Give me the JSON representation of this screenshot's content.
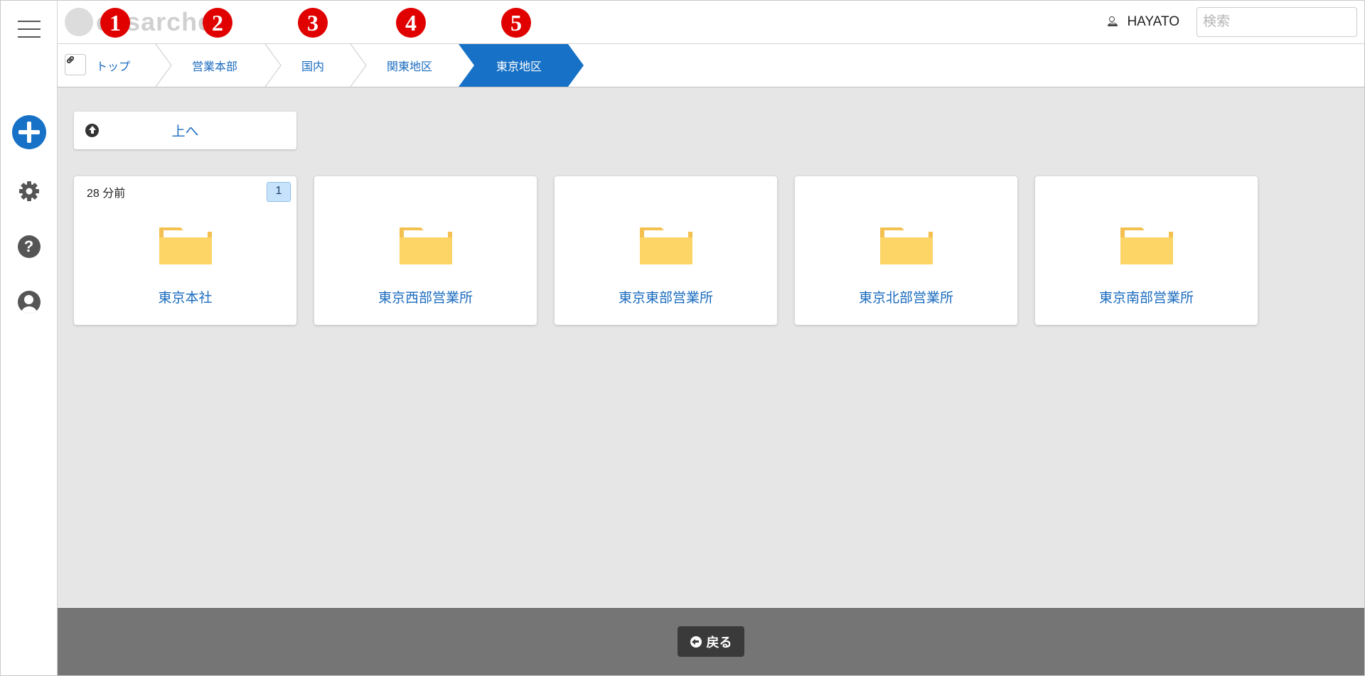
{
  "app": {
    "logo_text": "easarcher"
  },
  "annotations": [
    "1",
    "2",
    "3",
    "4",
    "5"
  ],
  "header": {
    "username": "HAYATO",
    "search_placeholder": "検索"
  },
  "breadcrumb": [
    {
      "label": "トップ",
      "active": false
    },
    {
      "label": "営業本部",
      "active": false
    },
    {
      "label": "国内",
      "active": false
    },
    {
      "label": "関東地区",
      "active": false
    },
    {
      "label": "東京地区",
      "active": true
    }
  ],
  "toolbar": {
    "up_label": "上へ"
  },
  "folders": [
    {
      "name": "東京本社",
      "updated": "28 分前",
      "count": "1"
    },
    {
      "name": "東京西部営業所"
    },
    {
      "name": "東京東部営業所"
    },
    {
      "name": "東京北部営業所"
    },
    {
      "name": "東京南部営業所"
    }
  ],
  "footer": {
    "back_label": "戻る"
  },
  "colors": {
    "accent": "#1771c6",
    "link": "#1a6bbf",
    "annotation": "#e00000",
    "folder": "#fcd566",
    "footer": "#757575"
  },
  "icons": {
    "menu": "hamburger-icon",
    "add": "plus-circle-icon",
    "settings": "gear-icon",
    "help": "question-icon",
    "account": "user-circle-icon",
    "link": "link-icon",
    "up": "arrow-up-circle-icon",
    "back": "arrow-left-circle-icon",
    "folder": "folder-icon"
  }
}
